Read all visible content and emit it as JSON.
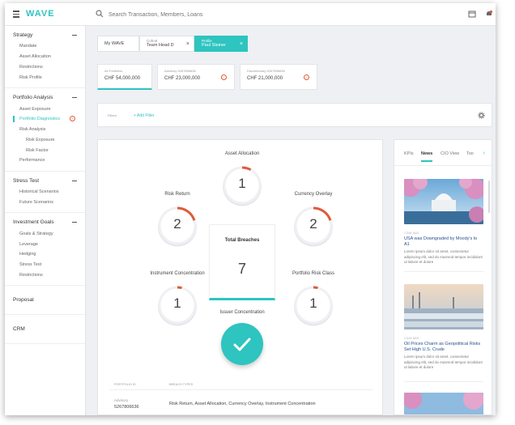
{
  "app": {
    "logo": "WAVE"
  },
  "search": {
    "placeholder": "Search Transaction, Members, Loans"
  },
  "sidebar": {
    "sections": [
      {
        "title": "Strategy",
        "items": [
          "Mandate",
          "Asset Allocation",
          "Restrictions",
          "Risk Profile"
        ]
      },
      {
        "title": "Portfolio Analysis",
        "items": [
          "Asset Exposure",
          "Portfolio Diagnostics",
          "Risk Analysis",
          "Risk Exposure",
          "Risk Factor",
          "Performance"
        ]
      },
      {
        "title": "Stress Test",
        "items": [
          "Historical Scenarios",
          "Future Scenarios"
        ]
      },
      {
        "title": "Investment Goals",
        "items": [
          "Goals & Strategy",
          "Leverage",
          "Hedging",
          "Stress Test",
          "Restrictions"
        ]
      }
    ],
    "singles": [
      "Proposal",
      "CRM"
    ]
  },
  "context_tabs": [
    {
      "label": "My WAVE",
      "value": ""
    },
    {
      "label": "Cohort",
      "value": "Team Head D"
    },
    {
      "label": "Profile",
      "value": "Paul Steiner"
    }
  ],
  "portfolio_cards": [
    {
      "title": "All Portfolios",
      "value": "CHF 54,000,000"
    },
    {
      "title": "Advisory 5267806636",
      "value": "CHF 23,000,000"
    },
    {
      "title": "Discretionary 5267806636",
      "value": "CHF 21,000,000"
    }
  ],
  "filters": {
    "label": "Filters",
    "add_label": "+ Add Filter"
  },
  "breaches": {
    "gauges": {
      "asset_allocation": {
        "label": "Asset Allocation",
        "value": "1",
        "fraction": 0.08
      },
      "risk_return": {
        "label": "Risk Return",
        "value": "2",
        "fraction": 0.2
      },
      "currency_overlay": {
        "label": "Currency Overlay",
        "value": "2",
        "fraction": 0.2
      },
      "instrument_concentration": {
        "label": "Instrument Concentration",
        "value": "1",
        "fraction": 0.04
      },
      "portfolio_risk_class": {
        "label": "Portfolio Risk Class",
        "value": "1",
        "fraction": 0.04
      }
    },
    "total": {
      "label": "Total Breaches",
      "value": "7"
    },
    "issuer": {
      "label": "Issuer Concentration"
    }
  },
  "table": {
    "headers": [
      "PORTFOLIO ID",
      "BREACH TYPES"
    ],
    "rows": [
      {
        "type": "Advisory",
        "id": "5267806636",
        "breaches": "Risk Return, Asset Allocation, Currency Overlay, Instrument Concentration"
      }
    ]
  },
  "news": {
    "tabs": [
      "KPIs",
      "News",
      "CIO View",
      "Too"
    ],
    "selected_tab": "News",
    "items": [
      {
        "date": "1 DAY AGO",
        "title": "USA was Downgraded by Moody's to A1",
        "body": "Lorem ipsum dolor sit amet, consectetur adipiscing elit, sed do eiusmod tempor incididunt ut labore et dolore"
      },
      {
        "date": "1 DAY AGO",
        "title": "Oil Prices Charm as Geopolitical Risks Set High U.S. Crude",
        "body": "Lorem ipsum dolor sit amet, consectetur adipiscing elit, sed do eiusmod tempor incididunt ut labore et dolore"
      }
    ]
  },
  "colors": {
    "accent": "#2ec4c0",
    "alert": "#e05a3a",
    "gauge_track": "#eef0f3"
  }
}
